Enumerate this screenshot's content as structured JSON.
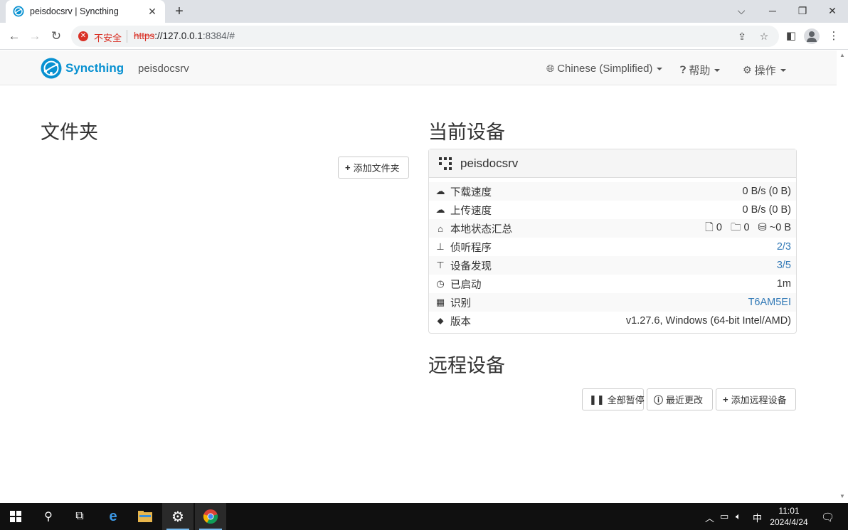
{
  "browser": {
    "tab_title": "peisdocsrv | Syncthing",
    "tab_close": "✕",
    "new_tab": "+",
    "security_label": "不安全",
    "url_scheme": "https",
    "url_rest": "://127.0.0.1",
    "url_port_path": ":8384/#"
  },
  "navbar": {
    "brand": "Syncthing",
    "device_name": "peisdocsrv",
    "language": "Chinese (Simplified)",
    "help": "帮助",
    "actions": "操作"
  },
  "folders": {
    "title": "文件夹",
    "add_button": "添加文件夹"
  },
  "this_device": {
    "title": "当前设备",
    "name": "peisdocsrv",
    "rows": [
      {
        "icon": "cloud-download-icon",
        "label": "下载速度",
        "value": "0 B/s (0 B)"
      },
      {
        "icon": "cloud-upload-icon",
        "label": "上传速度",
        "value": "0 B/s (0 B)"
      },
      {
        "icon": "home-icon",
        "label": "本地状态汇总",
        "files": "0",
        "dirs": "0",
        "size": "~0 B"
      },
      {
        "icon": "sitemap-icon",
        "label": "侦听程序",
        "value": "2/3"
      },
      {
        "icon": "signpost-icon",
        "label": "设备发现",
        "value": "3/5"
      },
      {
        "icon": "clock-icon",
        "label": "已启动",
        "value": "1m"
      },
      {
        "icon": "qrcode-icon",
        "label": "识别",
        "value": "T6AM5EI"
      },
      {
        "icon": "tag-icon",
        "label": "版本",
        "value": "v1.27.6, Windows (64-bit Intel/AMD)"
      }
    ]
  },
  "remote_devices": {
    "title": "远程设备",
    "pause_all": "全部暂停",
    "recent_changes": "最近更改",
    "add_remote": "添加远程设备"
  },
  "taskbar": {
    "time": "11:01",
    "date": "2024/4/24",
    "ime": "中"
  },
  "colors": {
    "brand": "#0891d1",
    "link": "#337ab7",
    "insecure": "#d93025"
  }
}
